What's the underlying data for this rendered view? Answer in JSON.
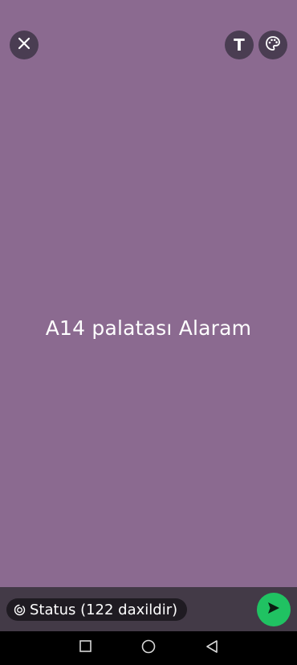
{
  "canvas": {
    "background_color": "#8b6a90",
    "status_text": "A14 palatası Alaram"
  },
  "toolbar": {
    "close_icon": "close-icon",
    "text_tool_label": "T",
    "palette_icon": "palette-icon"
  },
  "composer": {
    "audience_label": "Status (122 daxildir)",
    "audience_icon": "status-icon",
    "send_icon": "send-icon",
    "send_color": "#20c262"
  },
  "system_nav": {
    "recents_icon": "square-icon",
    "home_icon": "circle-icon",
    "back_icon": "triangle-back-icon"
  }
}
